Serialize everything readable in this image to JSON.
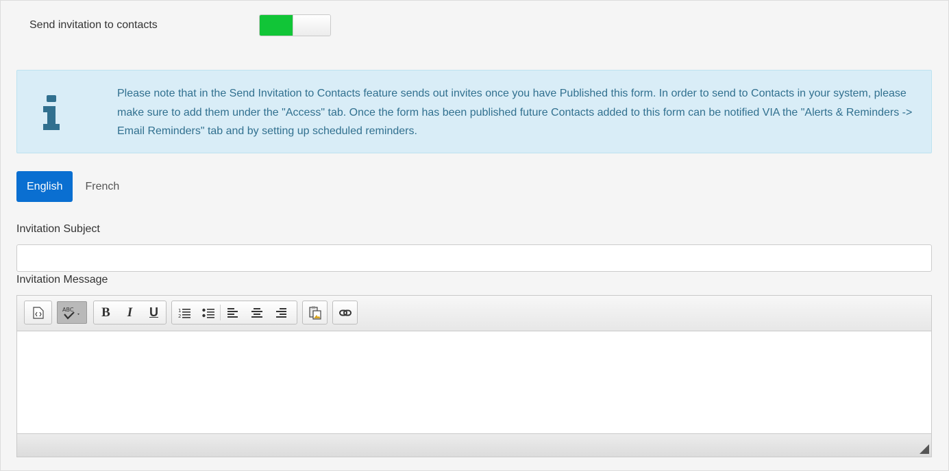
{
  "invitation": {
    "toggle_label": "Send invitation to contacts",
    "toggle_on": true,
    "toggle_color": "#11c537"
  },
  "info": {
    "icon": "info-icon",
    "text": "Please note that in the Send Invitation to Contacts feature sends out invites once you have Published this form. In order to send to Contacts in your system, please make sure to add them under the \"Access\" tab. Once the form has been published future Contacts added to this form can be notified VIA the \"Alerts & Reminders -> Email Reminders\" tab and by setting up scheduled reminders.",
    "color": "#31708f",
    "background": "#d9edf7"
  },
  "language_tabs": [
    {
      "label": "English",
      "active": true
    },
    {
      "label": "French",
      "active": false
    }
  ],
  "form": {
    "subject_label": "Invitation Subject",
    "subject_value": "",
    "message_label": "Invitation Message"
  },
  "editor": {
    "toolbar_icons": [
      "source-icon",
      "spellcheck-icon",
      "bold-icon",
      "italic-icon",
      "underline-icon",
      "numbered-list-icon",
      "bulleted-list-icon",
      "align-left-icon",
      "align-center-icon",
      "align-right-icon",
      "paste-icon",
      "link-icon"
    ],
    "bold_glyph": "B",
    "italic_glyph": "I",
    "underline_glyph": "U",
    "spellcheck_glyph": "ABC",
    "body_text": ""
  },
  "colors": {
    "accent": "#0a6fd1",
    "background": "#f5f5f5"
  }
}
